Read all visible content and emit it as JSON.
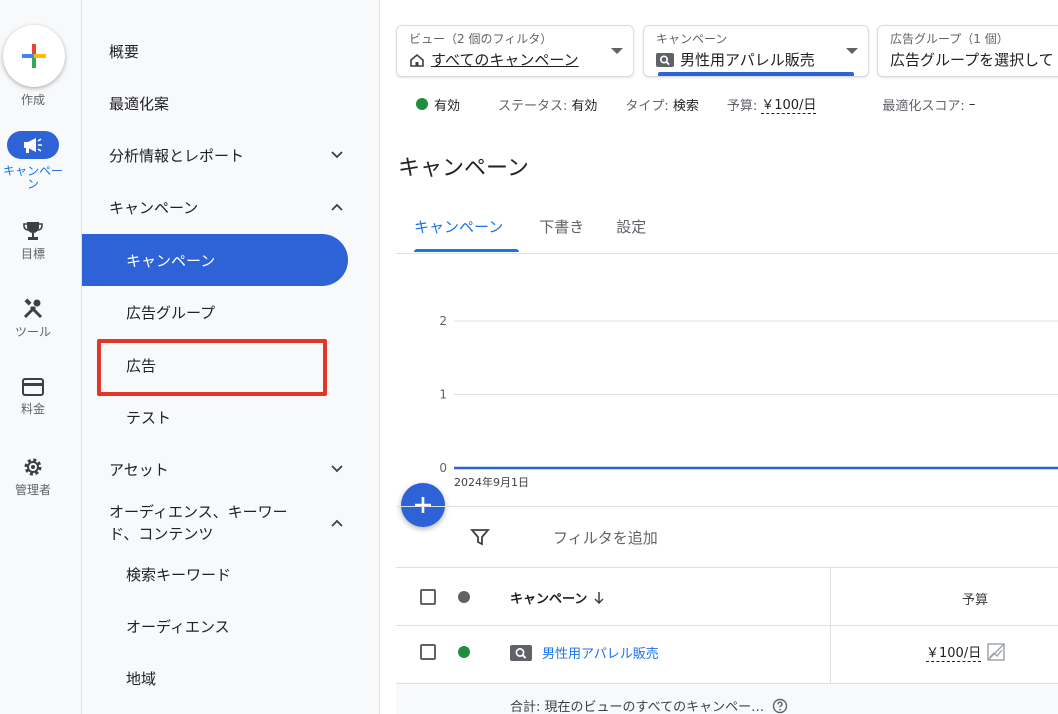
{
  "rail": {
    "create_label": "作成",
    "items": [
      {
        "label": "キャンペーン",
        "icon": "megaphone-icon",
        "active": true
      },
      {
        "label": "目標",
        "icon": "trophy-icon"
      },
      {
        "label": "ツール",
        "icon": "tools-icon"
      },
      {
        "label": "料金",
        "icon": "credit-card-icon"
      },
      {
        "label": "管理者",
        "icon": "gear-icon"
      }
    ]
  },
  "nav": {
    "items": [
      {
        "label": "概要"
      },
      {
        "label": "最適化案"
      },
      {
        "label": "分析情報とレポート",
        "chevron": "down"
      },
      {
        "label": "キャンペーン",
        "chevron": "up"
      },
      {
        "label": "キャンペーン",
        "selected": true
      },
      {
        "label": "広告グループ"
      },
      {
        "label": "広告"
      },
      {
        "label": "テスト"
      },
      {
        "label": "アセット",
        "chevron": "down"
      },
      {
        "label": "オーディエンス、キーワード、コンテンツ",
        "chevron": "up"
      },
      {
        "label": "検索キーワード"
      },
      {
        "label": "オーディエンス"
      },
      {
        "label": "地域"
      }
    ]
  },
  "pickers": {
    "view": {
      "title": "ビュー（2 個のフィルタ）",
      "value": "すべてのキャンペーン"
    },
    "campaign": {
      "title": "キャンペーン",
      "value": "男性用アパレル販売"
    },
    "adgroup": {
      "title": "広告グループ（1 個）",
      "value": "広告グループを選択して"
    }
  },
  "status": {
    "enabled": "有効",
    "status_label": "ステータス:",
    "status_value": "有効",
    "type_label": "タイプ:",
    "type_value": "検索",
    "budget_label": "予算:",
    "budget_value": "￥100/日",
    "score_label": "最適化スコア:",
    "score_value": "–"
  },
  "page_title": "キャンペーン",
  "tabs": [
    "キャンペーン",
    "下書き",
    "設定"
  ],
  "chart_data": {
    "type": "line",
    "x": [
      "2024年9月1日"
    ],
    "series": [
      {
        "values": [
          0
        ]
      }
    ],
    "ylim": [
      0,
      2
    ],
    "yticks": [
      "0",
      "1",
      "2"
    ],
    "grid": true
  },
  "filter": {
    "placeholder": "フィルタを追加"
  },
  "table": {
    "header_campaign": "キャンペーン",
    "header_budget": "予算",
    "rows": [
      {
        "campaign": "男性用アパレル販売",
        "budget": "￥100/日"
      }
    ],
    "total": "合計: 現在のビューのすべてのキャンペー…"
  },
  "colors": {
    "accent": "#2d63d6",
    "link": "#1a73e8",
    "enabled": "#1e8e3e",
    "highlight": "#e53527"
  }
}
